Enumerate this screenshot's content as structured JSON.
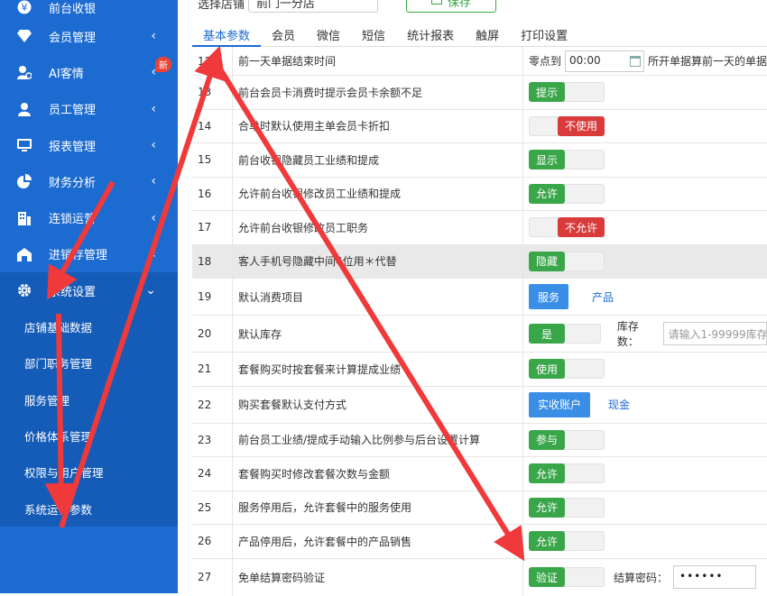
{
  "sidebar": {
    "items": [
      {
        "label": "前台收银",
        "icon": "yen-icon",
        "chevron": ""
      },
      {
        "label": "会员管理",
        "icon": "diamond-icon",
        "chevron": "‹"
      },
      {
        "label": "AI客情",
        "icon": "ai-user-icon",
        "chevron": "‹",
        "badge": "新"
      },
      {
        "label": "员工管理",
        "icon": "user-icon",
        "chevron": "‹"
      },
      {
        "label": "报表管理",
        "icon": "monitor-icon",
        "chevron": "‹"
      },
      {
        "label": "财务分析",
        "icon": "pie-chart-icon",
        "chevron": "‹"
      },
      {
        "label": "连锁运营",
        "icon": "building-icon",
        "chevron": "‹"
      },
      {
        "label": "进销存管理",
        "icon": "warehouse-icon",
        "chevron": "‹"
      },
      {
        "label": "系统设置",
        "icon": "gear-icon",
        "chevron": "⌄"
      }
    ],
    "submenu": [
      "店铺基础数据",
      "部门职务管理",
      "服务管理",
      "价格体系管理",
      "权限与用户管理",
      "系统运行参数"
    ]
  },
  "topbar": {
    "store_label": "选择店铺",
    "store_value": "前门一分店",
    "save_label": "保存"
  },
  "tabs": [
    "基本参数",
    "会员",
    "微信",
    "短信",
    "统计报表",
    "触屏",
    "打印设置"
  ],
  "rows": [
    {
      "no": "12",
      "name": "前一天单据结束时间"
    },
    {
      "no": "13",
      "name": "前台会员卡消费时提示会员卡余额不足"
    },
    {
      "no": "14",
      "name": "合单时默认使用主单会员卡折扣"
    },
    {
      "no": "15",
      "name": "前台收银隐藏员工业绩和提成"
    },
    {
      "no": "16",
      "name": "允许前台收银修改员工业绩和提成"
    },
    {
      "no": "17",
      "name": "允许前台收银修改员工职务"
    },
    {
      "no": "18",
      "name": "客人手机号隐藏中间4位用＊代替"
    },
    {
      "no": "19",
      "name": "默认消费项目"
    },
    {
      "no": "20",
      "name": "默认库存"
    },
    {
      "no": "21",
      "name": "套餐购买时按套餐来计算提成业绩"
    },
    {
      "no": "22",
      "name": "购买套餐默认支付方式"
    },
    {
      "no": "23",
      "name": "前台员工业绩/提成手动输入比例参与后台设置计算"
    },
    {
      "no": "24",
      "name": "套餐购买时修改套餐次数与金额"
    },
    {
      "no": "25",
      "name": "服务停用后，允许套餐中的服务使用"
    },
    {
      "no": "26",
      "name": "产品停用后，允许套餐中的产品销售"
    },
    {
      "no": "27",
      "name": "免单结算密码验证"
    }
  ],
  "controls": {
    "r12": {
      "prefix": "零点到",
      "time": "00:00",
      "suffix": "所开单据算前一天的单据"
    },
    "r13": "提示",
    "r14": "不使用",
    "r15": "显示",
    "r16": "允许",
    "r17": "不允许",
    "r18": "隐藏",
    "r19": {
      "primary": "服务",
      "alt": "产品"
    },
    "r20": {
      "switch": "是",
      "label": "库存数：",
      "placeholder": "请输入1-99999库存"
    },
    "r21": "使用",
    "r22": {
      "primary": "实收账户",
      "alt": "现金"
    },
    "r23": "参与",
    "r24": "允许",
    "r25": "允许",
    "r26": "允许",
    "r27": {
      "switch": "验证",
      "label": "结算密码：",
      "value": "••••••"
    }
  },
  "colors": {
    "sidebar": "#1c6bd1",
    "switch_on": "#3aa64a",
    "switch_off": "#d93b3b",
    "arrow": "#f0393a"
  }
}
